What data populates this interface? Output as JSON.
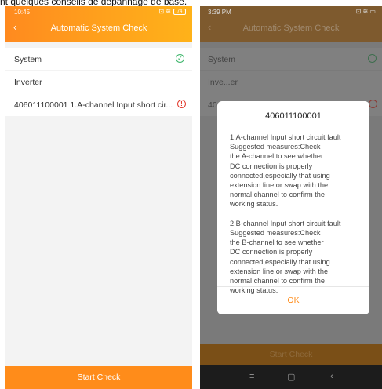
{
  "caption": "nt quelques conseils de dépannage de base.",
  "left": {
    "status_time": "10:45",
    "status_icons": "⊡ ≋",
    "battery": "74",
    "title": "Automatic System Check",
    "back_icon": "‹",
    "rows": [
      {
        "label": "System",
        "state": "ok"
      },
      {
        "label": "Inverter",
        "state": "none"
      },
      {
        "label": "406011100001   1.A-channel Input short cir...",
        "state": "warn"
      }
    ],
    "start_label": "Start Check"
  },
  "right": {
    "status_time": "3:39 PM",
    "status_icons": "⊡ ≋ ▭",
    "title": "Automatic System Check",
    "back_icon": "‹",
    "rows": [
      {
        "label": "System"
      },
      {
        "label": "Inve...er"
      },
      {
        "label": "40"
      }
    ],
    "start_label": "Start Check",
    "nav": {
      "menu": "≡",
      "home": "▢",
      "back": "‹"
    },
    "dialog": {
      "title": "406011100001",
      "message": "1.A-channel Input short circuit fault\nSuggested measures:Check\nthe A-channel to see whether\nDC connection is properly\nconnected,especially that using\nextension line or swap with the\nnormal channel to confirm the\nworking status.\n\n2.B-channel Input short circuit fault\nSuggested measures:Check\nthe B-channel to see whether\nDC connection is properly\nconnected,especially that using\nextension line or swap with the\nnormal channel to confirm the\nworking status.",
      "ok_label": "OK"
    }
  }
}
